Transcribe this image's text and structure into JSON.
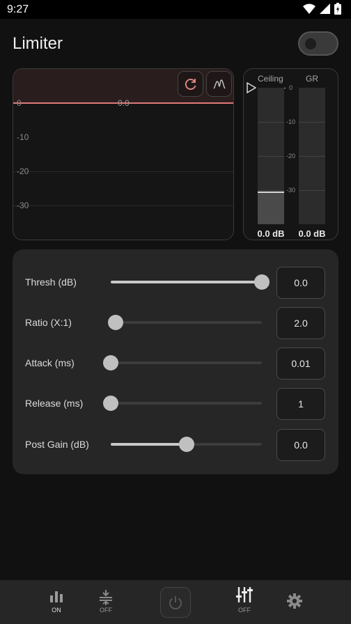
{
  "status": {
    "time": "9:27"
  },
  "title": "Limiter",
  "toggle": {
    "enabled": false
  },
  "graph": {
    "labels": [
      "0",
      "-10",
      "-20",
      "-30"
    ],
    "marker": "0.0",
    "buttons": [
      {
        "name": "reset-icon",
        "color": "#e88a8a"
      },
      {
        "name": "waveform-icon",
        "color": "#c8c8c8"
      }
    ]
  },
  "meters": {
    "ceiling": {
      "label": "Ceiling",
      "value": "0.0 dB",
      "level_db": -30.5
    },
    "gr": {
      "label": "GR",
      "value": "0.0 dB"
    },
    "ticks": [
      "0",
      "-10",
      "-20",
      "-30"
    ]
  },
  "params": [
    {
      "label": "Thresh (dB)",
      "value": "0.0",
      "position": 1.0
    },
    {
      "label": "Ratio (X:1)",
      "value": "2.0",
      "position": 0.03
    },
    {
      "label": "Attack (ms)",
      "value": "0.01",
      "position": 0.0
    },
    {
      "label": "Release (ms)",
      "value": "1",
      "position": 0.0
    },
    {
      "label": "Post Gain (dB)",
      "value": "0.0",
      "position": 0.5
    }
  ],
  "nav": {
    "items": [
      {
        "name": "equalizer",
        "label": "ON"
      },
      {
        "name": "compressor",
        "label": "OFF"
      },
      {
        "name": "limiter",
        "label": "OFF"
      },
      {
        "name": "settings",
        "label": ""
      }
    ]
  },
  "colors": {
    "accent": "#e07a7a",
    "background": "#111111",
    "panel": "#262626"
  }
}
